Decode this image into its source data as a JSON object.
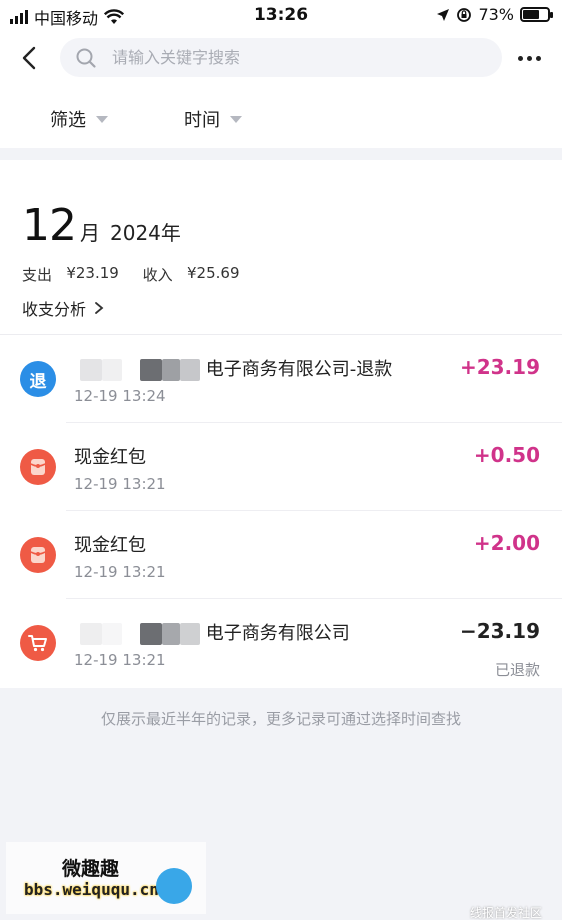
{
  "status_bar": {
    "carrier": "中国移动",
    "time": "13:26",
    "battery": "73%",
    "battery_level": 0.73
  },
  "search": {
    "placeholder": "请输入关键字搜索"
  },
  "filters": [
    {
      "label": "筛选"
    },
    {
      "label": "时间"
    }
  ],
  "summary": {
    "month": "12",
    "month_unit": "月",
    "year": "2024年",
    "expense_label": "支出",
    "expense": "¥23.19",
    "income_label": "收入",
    "income": "¥25.69",
    "analysis_label": "收支分析"
  },
  "transactions": [
    {
      "icon": "refund-icon",
      "icon_text": "退",
      "icon_color": "#2b8ee6",
      "title": "电子商务有限公司-退款",
      "time": "12-19 13:24",
      "amount": "+23.19",
      "amount_color": "#d0338a",
      "note": ""
    },
    {
      "icon": "red-packet-icon",
      "icon_text": "",
      "icon_color": "#ef5a45",
      "title": "现金红包",
      "time": "12-19 13:21",
      "amount": "+0.50",
      "amount_color": "#d0338a",
      "note": ""
    },
    {
      "icon": "red-packet-icon",
      "icon_text": "",
      "icon_color": "#ef5a45",
      "title": "现金红包",
      "time": "12-19 13:21",
      "amount": "+2.00",
      "amount_color": "#d0338a",
      "note": ""
    },
    {
      "icon": "shopping-cart-icon",
      "icon_text": "",
      "icon_color": "#ef5a45",
      "title": "电子商务有限公司",
      "time": "12-19 13:21",
      "amount": "−23.19",
      "amount_color": "#222222",
      "note": "已退款"
    }
  ],
  "footer_note": "仅展示最近半年的记录，更多记录可通过选择时间查找",
  "watermark": {
    "line1": "微趣趣",
    "line2": "bbs.weiququ.cn",
    "corner": "线报首发社区"
  }
}
